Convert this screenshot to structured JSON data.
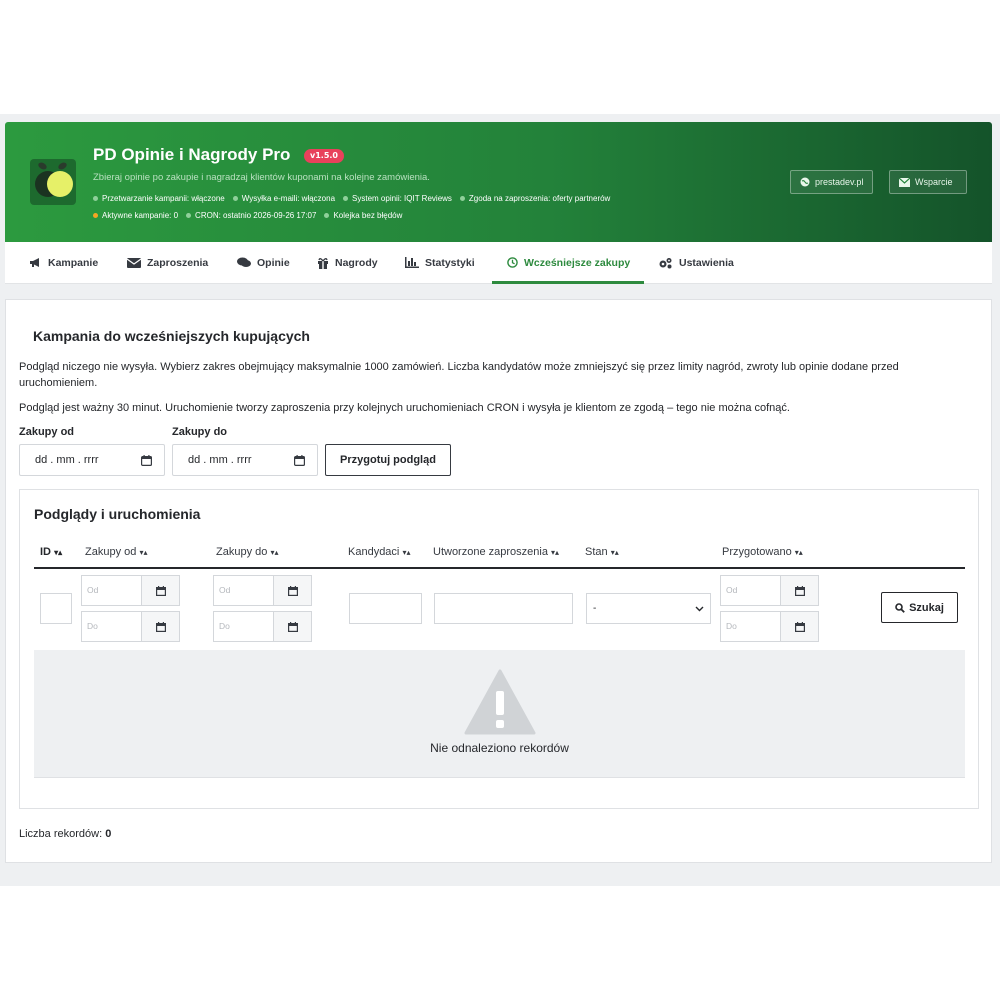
{
  "header": {
    "title": "PD Opinie i Nagrody Pro",
    "version": "v1.5.0",
    "subtitle": "Zbieraj opinie po zakupie i nagradzaj klientów kuponami na kolejne zamówienia.",
    "status_row1": [
      {
        "text": "Przetwarzanie kampanii: włączone",
        "color": "#8fd09a"
      },
      {
        "text": "Wysyłka e-maili: włączona",
        "color": "#8fd09a"
      },
      {
        "text": "System opinii: IQIT Reviews",
        "color": "#8fd09a"
      },
      {
        "text": "Zgoda na zaproszenia: oferty partnerów",
        "color": "#8fd09a"
      }
    ],
    "status_row2": [
      {
        "text": "Aktywne kampanie: 0",
        "color": "#f5a623"
      },
      {
        "text": "CRON: ostatnio 2026-09-26 17:07",
        "color": "#8fd09a"
      },
      {
        "text": "Kolejka bez błędów",
        "color": "#8fd09a"
      }
    ],
    "links": {
      "site": "prestadev.pl",
      "support": "Wsparcie"
    }
  },
  "tabs": [
    {
      "label": "Kampanie",
      "icon": "megaphone-icon"
    },
    {
      "label": "Zaproszenia",
      "icon": "envelope-icon"
    },
    {
      "label": "Opinie",
      "icon": "comments-icon"
    },
    {
      "label": "Nagrody",
      "icon": "gift-icon"
    },
    {
      "label": "Statystyki",
      "icon": "bar-chart-icon"
    },
    {
      "label": "Wcześniejsze zakupy",
      "icon": "clock-icon",
      "active": true
    },
    {
      "label": "Ustawienia",
      "icon": "cogs-icon"
    }
  ],
  "main": {
    "title": "Kampania do wcześniejszych kupujących",
    "paragraph1": "Podgląd niczego nie wysyła. Wybierz zakres obejmujący maksymalnie 1000 zamówień. Liczba kandydatów może zmniejszyć się przez limity nagród, zwroty lub opinie dodane przed uruchomieniem.",
    "paragraph2": "Podgląd jest ważny 30 minut. Uruchomienie tworzy zaproszenia przy kolejnych uruchomieniach CRON i wysyła je klientom ze zgodą – tego nie można cofnąć.",
    "from_label": "Zakupy od",
    "to_label": "Zakupy do",
    "date_placeholder": "dd . mm . rrrr",
    "prepare_button": "Przygotuj podgląd"
  },
  "list": {
    "title": "Podglądy i uruchomienia",
    "columns": [
      "ID",
      "Zakupy od",
      "Zakupy do",
      "Kandydaci",
      "Utworzone zaproszenia",
      "Stan",
      "Przygotowano"
    ],
    "filter_from": "Od",
    "filter_to": "Do",
    "state_value": "-",
    "search_button": "Szukaj",
    "empty_text": "Nie odnaleziono rekordów"
  },
  "footer": {
    "count_label": "Liczba rekordów:",
    "count_value": "0"
  }
}
